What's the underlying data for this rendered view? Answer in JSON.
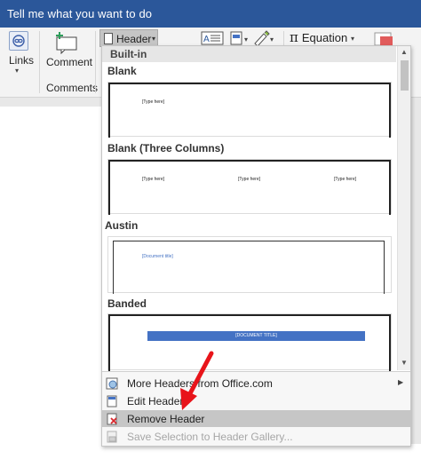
{
  "titlebar": {
    "search_placeholder": "Tell me what you want to do"
  },
  "ribbon": {
    "links_label": "Links",
    "comment_label": "Comment",
    "comments_group": "Comments",
    "header_label": "Header",
    "equation_label": "Equation"
  },
  "dropdown": {
    "section_label": "Built-in",
    "gallery": [
      {
        "title": "Blank",
        "placeholders": [
          "[Type here]"
        ]
      },
      {
        "title": "Blank (Three Columns)",
        "placeholders": [
          "[Type here]",
          "[Type here]",
          "[Type here]"
        ]
      },
      {
        "title": "Austin",
        "placeholders": [
          "[Document title]"
        ]
      },
      {
        "title": "Banded",
        "placeholders": [
          "[DOCUMENT TITLE]"
        ]
      }
    ],
    "menu": [
      {
        "label": "More Headers from Office.com",
        "highlighted": false,
        "disabled": false
      },
      {
        "label": "Edit Header",
        "highlighted": false,
        "disabled": false
      },
      {
        "label": "Remove Header",
        "highlighted": true,
        "disabled": false
      },
      {
        "label": "Save Selection to Header Gallery...",
        "highlighted": false,
        "disabled": true
      }
    ]
  },
  "colors": {
    "titlebar": "#2b579a",
    "banded": "#4472c4",
    "annotation_arrow": "#e8141a",
    "highlight": "#c6c6c6"
  }
}
